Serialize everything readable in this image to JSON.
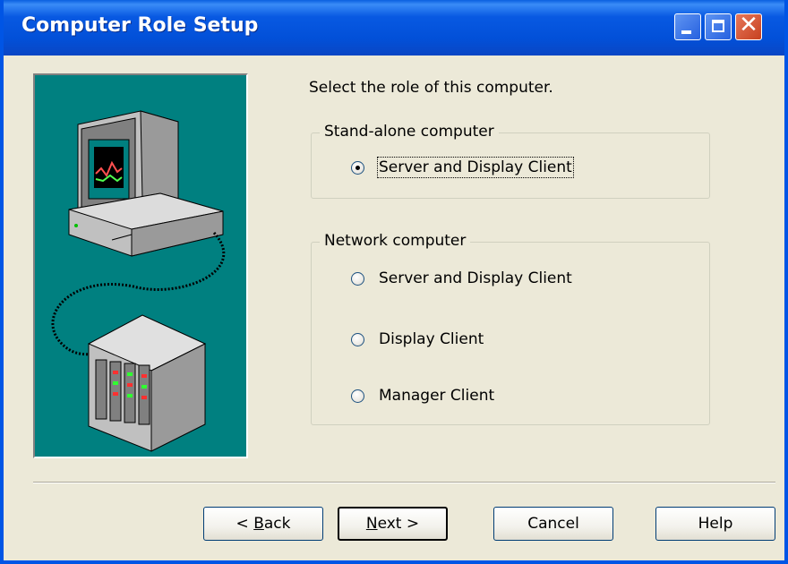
{
  "window": {
    "title": "Computer Role Setup",
    "controls": {
      "minimize": "minimize-icon",
      "maximize": "maximize-icon",
      "close": "close-icon"
    }
  },
  "prompt": "Select the role of this computer.",
  "groups": {
    "standalone": {
      "legend": "Stand-alone computer",
      "options": [
        {
          "label": "Server and Display Client",
          "selected": true
        }
      ]
    },
    "network": {
      "legend": "Network computer",
      "options": [
        {
          "label": "Server and Display Client",
          "selected": false
        },
        {
          "label": "Display Client",
          "selected": false
        },
        {
          "label": "Manager Client",
          "selected": false
        }
      ]
    }
  },
  "buttons": {
    "back": {
      "prefix": "< ",
      "mnemonic": "B",
      "rest": "ack"
    },
    "next": {
      "mnemonic": "N",
      "rest": "ext >"
    },
    "cancel": "Cancel",
    "help": "Help"
  },
  "colors": {
    "titlebar": "#0250d8",
    "dialog_bg": "#ece9d8",
    "illustration_bg": "#008080"
  }
}
